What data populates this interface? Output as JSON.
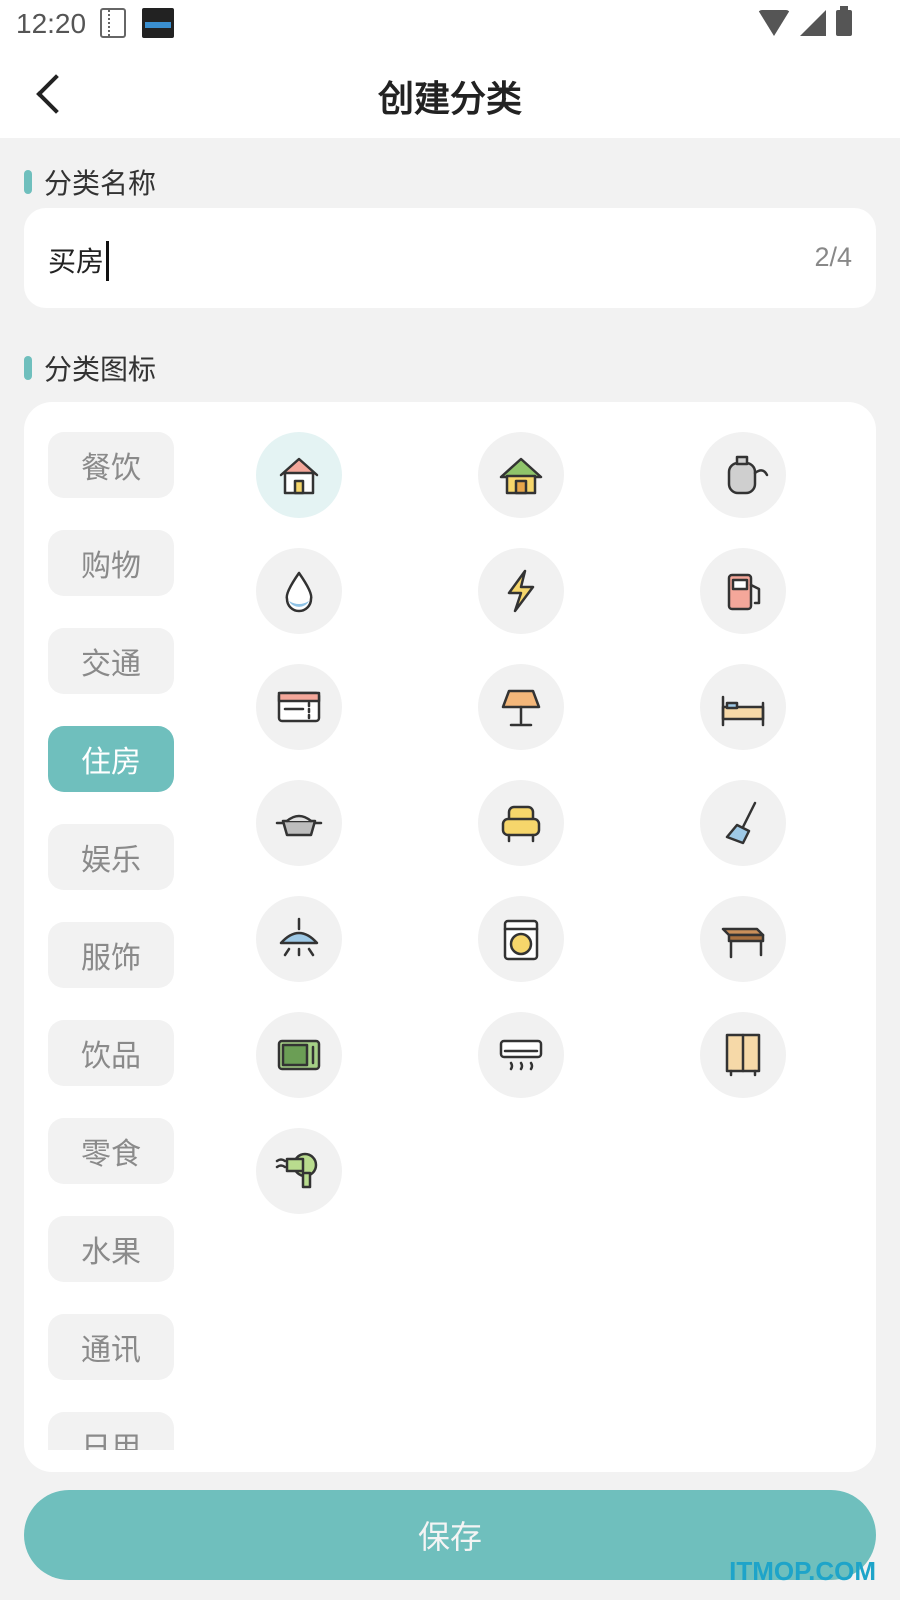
{
  "status": {
    "time": "12:20"
  },
  "header": {
    "title": "创建分类"
  },
  "name_section": {
    "label": "分类名称",
    "value": "买房",
    "count": "2/4"
  },
  "icon_section": {
    "label": "分类图标"
  },
  "categories": [
    {
      "label": "餐饮",
      "active": false
    },
    {
      "label": "购物",
      "active": false
    },
    {
      "label": "交通",
      "active": false
    },
    {
      "label": "住房",
      "active": true
    },
    {
      "label": "娱乐",
      "active": false
    },
    {
      "label": "服饰",
      "active": false
    },
    {
      "label": "饮品",
      "active": false
    },
    {
      "label": "零食",
      "active": false
    },
    {
      "label": "水果",
      "active": false
    },
    {
      "label": "通讯",
      "active": false
    },
    {
      "label": "日用",
      "active": false
    }
  ],
  "icons": [
    {
      "name": "house-icon",
      "selected": true
    },
    {
      "name": "green-roof-house-icon",
      "selected": false
    },
    {
      "name": "gas-tank-icon",
      "selected": false
    },
    {
      "name": "water-drop-icon",
      "selected": false
    },
    {
      "name": "lightning-icon",
      "selected": false
    },
    {
      "name": "gas-pump-icon",
      "selected": false
    },
    {
      "name": "ticket-icon",
      "selected": false
    },
    {
      "name": "table-lamp-icon",
      "selected": false
    },
    {
      "name": "bed-icon",
      "selected": false
    },
    {
      "name": "pot-icon",
      "selected": false
    },
    {
      "name": "armchair-icon",
      "selected": false
    },
    {
      "name": "broom-icon",
      "selected": false
    },
    {
      "name": "ceiling-lamp-icon",
      "selected": false
    },
    {
      "name": "washing-machine-icon",
      "selected": false
    },
    {
      "name": "table-icon",
      "selected": false
    },
    {
      "name": "microwave-icon",
      "selected": false
    },
    {
      "name": "air-conditioner-icon",
      "selected": false
    },
    {
      "name": "cabinet-icon",
      "selected": false
    },
    {
      "name": "hair-dryer-icon",
      "selected": false
    }
  ],
  "save_label": "保存",
  "watermark": "ITMOP.COM",
  "colors": {
    "accent": "#6fbfbd",
    "background": "#f2f2f2",
    "card": "#ffffff"
  }
}
